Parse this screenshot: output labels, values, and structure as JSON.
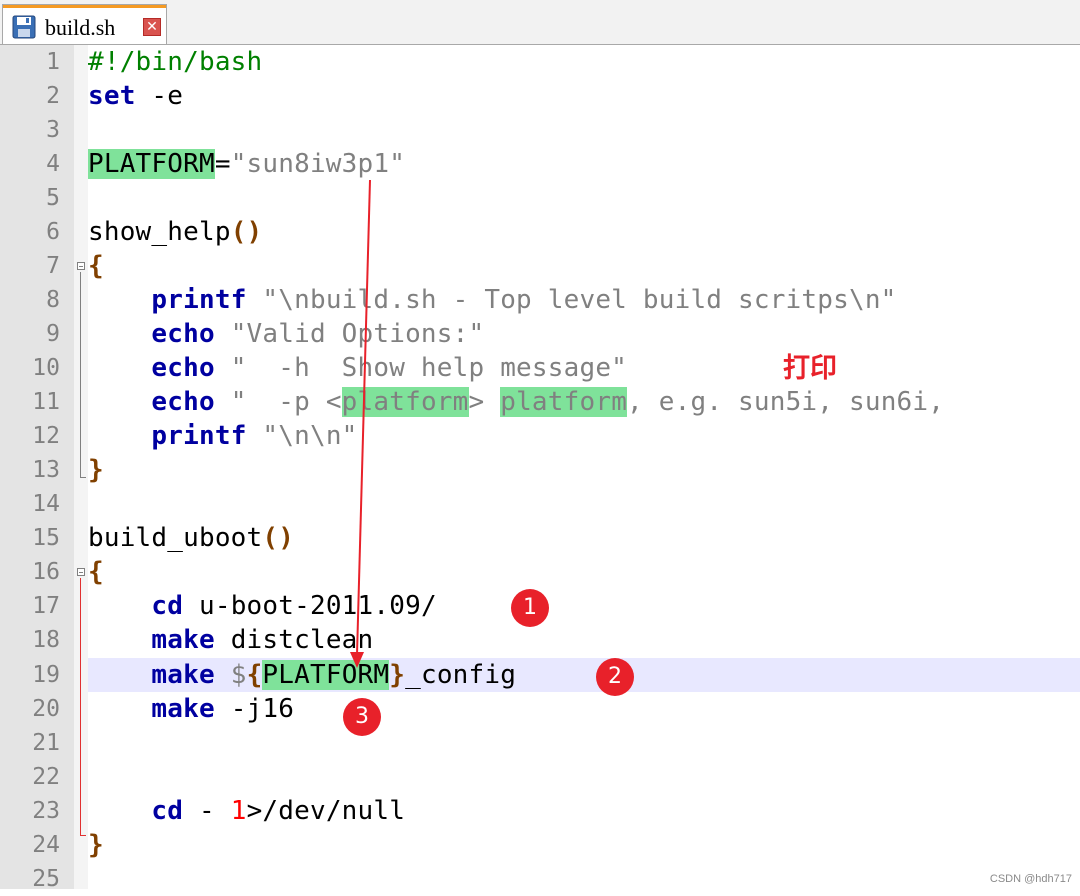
{
  "tab": {
    "label": "build.sh",
    "close": "✕"
  },
  "lines": [
    {
      "n": "1"
    },
    {
      "n": "2"
    },
    {
      "n": "3"
    },
    {
      "n": "4"
    },
    {
      "n": "5"
    },
    {
      "n": "6"
    },
    {
      "n": "7"
    },
    {
      "n": "8"
    },
    {
      "n": "9"
    },
    {
      "n": "10"
    },
    {
      "n": "11"
    },
    {
      "n": "12"
    },
    {
      "n": "13"
    },
    {
      "n": "14"
    },
    {
      "n": "15"
    },
    {
      "n": "16"
    },
    {
      "n": "17"
    },
    {
      "n": "18"
    },
    {
      "n": "19"
    },
    {
      "n": "20"
    },
    {
      "n": "21"
    },
    {
      "n": "22"
    },
    {
      "n": "23"
    },
    {
      "n": "24"
    },
    {
      "n": "25"
    }
  ],
  "code": {
    "l1": "#!/bin/bash",
    "l2_kw": "set",
    "l2_rest": " -e",
    "l4_var": "PLATFORM",
    "l4_eq": "=",
    "l4_str": "\"sun8iw3p1\"",
    "l6_name": "show_help",
    "l6_paren": "()",
    "l7": "{",
    "l8_kw": "printf",
    "l8_str": " \"\\nbuild.sh - Top level build scritps\\n\"",
    "l9_kw": "echo",
    "l9_str": " \"Valid Options:\"",
    "l10_kw": "echo",
    "l10_str": " \"  -h  Show help message\"",
    "l11_kw": "echo",
    "l11_str_a": " \"  -p <",
    "l11_hl1": "platform",
    "l11_str_b": "> ",
    "l11_hl2": "platform",
    "l11_str_c": ", e.g. sun5i, sun6i,",
    "l12_kw": "printf",
    "l12_str": " \"\\n\\n\"",
    "l13": "}",
    "l15_name": "build_uboot",
    "l15_paren": "()",
    "l16": "{",
    "l17_kw": "cd",
    "l17_rest": " u-boot-2011.09/",
    "l18_kw": "make",
    "l18_rest": " distclean",
    "l19_kw": "make",
    "l19_dollar": " $",
    "l19_brace_open": "{",
    "l19_hl": "PLATFORM",
    "l19_brace_close": "}",
    "l19_rest": "_config",
    "l20_kw": "make",
    "l20_rest": " -j16",
    "l23_kw": "cd",
    "l23_mid": " - ",
    "l23_num": "1",
    "l23_rest": ">/dev/null",
    "l24": "}"
  },
  "annotations": {
    "note": "打印",
    "badge1": "1",
    "badge2": "2",
    "badge3": "3",
    "color": "#e8212a"
  },
  "watermark": "CSDN @hdh717"
}
